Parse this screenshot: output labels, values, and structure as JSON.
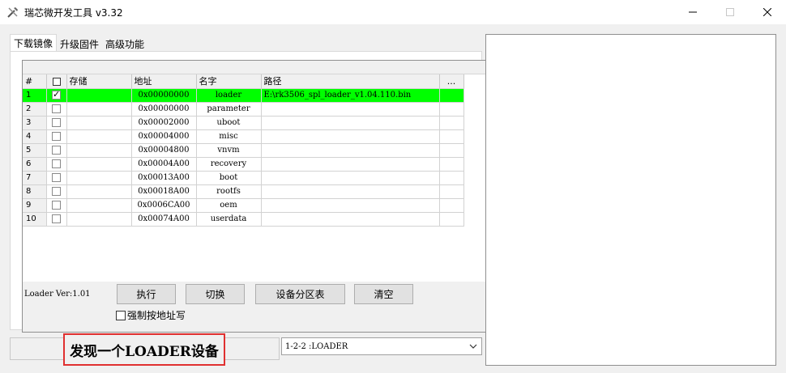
{
  "window": {
    "title": "瑞芯微开发工具 v3.32",
    "minimize": "—",
    "maximize": "☐",
    "close": "✕"
  },
  "tabs": [
    "下载镜像",
    "升级固件",
    "高级功能"
  ],
  "table": {
    "headers": [
      "#",
      "",
      "存储",
      "地址",
      "名字",
      "路径",
      "..."
    ],
    "rows": [
      {
        "num": "1",
        "checked": true,
        "storage": "",
        "address": "0x00000000",
        "name": "loader",
        "path": "E:\\rk3506_spl_loader_v1.04.110.bin"
      },
      {
        "num": "2",
        "checked": false,
        "storage": "",
        "address": "0x00000000",
        "name": "parameter",
        "path": ""
      },
      {
        "num": "3",
        "checked": false,
        "storage": "",
        "address": "0x00002000",
        "name": "uboot",
        "path": ""
      },
      {
        "num": "4",
        "checked": false,
        "storage": "",
        "address": "0x00004000",
        "name": "misc",
        "path": ""
      },
      {
        "num": "5",
        "checked": false,
        "storage": "",
        "address": "0x00004800",
        "name": "vnvm",
        "path": ""
      },
      {
        "num": "6",
        "checked": false,
        "storage": "",
        "address": "0x00004A00",
        "name": "recovery",
        "path": ""
      },
      {
        "num": "7",
        "checked": false,
        "storage": "",
        "address": "0x00013A00",
        "name": "boot",
        "path": ""
      },
      {
        "num": "8",
        "checked": false,
        "storage": "",
        "address": "0x00018A00",
        "name": "rootfs",
        "path": ""
      },
      {
        "num": "9",
        "checked": false,
        "storage": "",
        "address": "0x0006CA00",
        "name": "oem",
        "path": ""
      },
      {
        "num": "10",
        "checked": false,
        "storage": "",
        "address": "0x00074A00",
        "name": "userdata",
        "path": ""
      }
    ]
  },
  "loader_ver": "Loader Ver:1.01",
  "buttons": {
    "run": "执行",
    "switch": "切换",
    "partition_table": "设备分区表",
    "clear": "清空"
  },
  "force_by_address": "强制按地址写",
  "status_message": "发现一个LOADER设备",
  "device_select": "1-2-2 :LOADER",
  "colors": {
    "selected_row": "#00ff00",
    "status_border": "#e03030"
  }
}
